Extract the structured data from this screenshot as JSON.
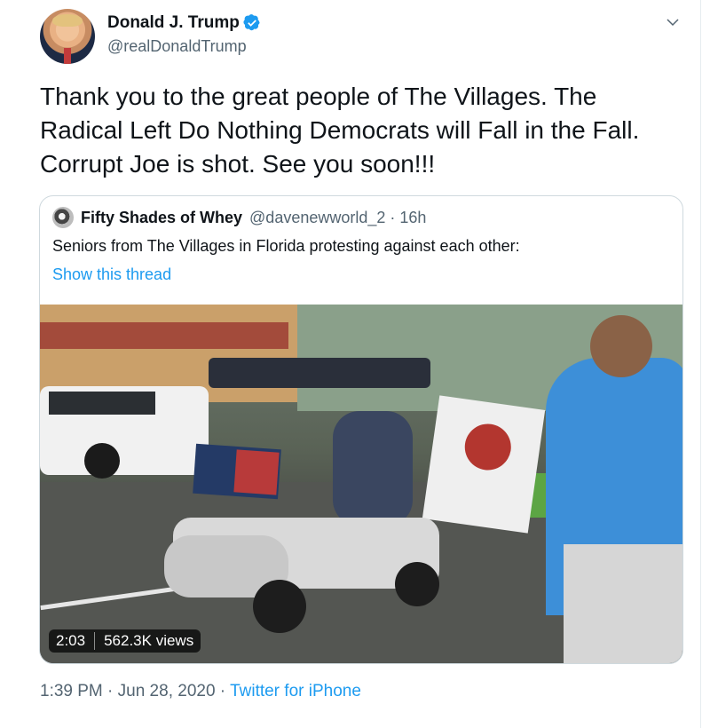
{
  "author": {
    "display_name": "Donald J. Trump",
    "handle": "@realDonaldTrump"
  },
  "tweet": {
    "text": "Thank you to the great people of The Villages. The Radical Left Do Nothing Democrats will Fall in the Fall. Corrupt Joe is shot. See you soon!!!"
  },
  "quoted": {
    "display_name": "Fifty Shades of Whey",
    "meta": "@davenewworld_2 · 16h",
    "text": "Seniors from The Villages in Florida protesting against each other:",
    "show_thread": "Show this thread",
    "video": {
      "duration": "2:03",
      "views": "562.3K views"
    }
  },
  "footer": {
    "time_date": "1:39 PM · Jun 28, 2020 · ",
    "source": "Twitter for iPhone"
  },
  "colors": {
    "link": "#1d9bf0",
    "verified": "#1d9bf0",
    "secondary_text": "#536471"
  },
  "icons": [
    "verified-badge-icon",
    "chevron-down-icon"
  ]
}
